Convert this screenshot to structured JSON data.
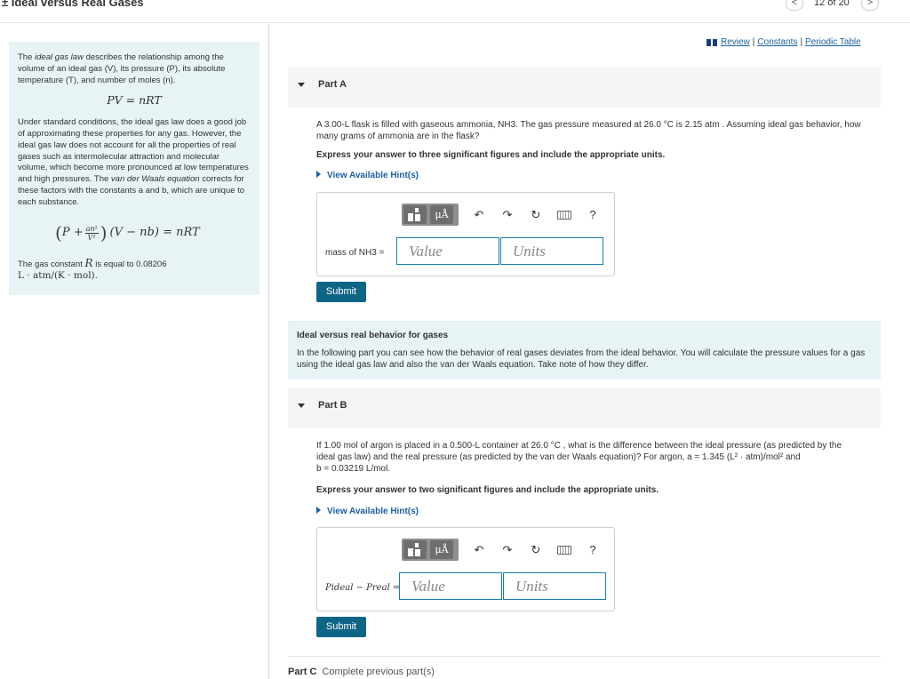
{
  "header": {
    "title": "± Ideal versus Real Gases",
    "pager_prev": "<",
    "pager_count": "12 of 20",
    "pager_next": ">"
  },
  "links": {
    "review": "Review",
    "constants": "Constants",
    "periodic": "Periodic Table",
    "sep": "|"
  },
  "left_panel": {
    "p1_a": "The ",
    "p1_em": "ideal gas law",
    "p1_b": " describes the relationship among the volume of an ideal gas (V), its pressure (P), its absolute temperature (T), and number of moles (n).",
    "eq1": "PV = nRT",
    "p2_a": "Under standard conditions, the ideal gas law does a good job of approximating these properties for any gas. However, the ideal gas law does not account for all the properties of real gases such as intermolecular attraction and molecular volume, which become more pronounced at low temperatures and high pressures. The ",
    "p2_em": "van der Waals equation",
    "p2_b": " corrects for these factors with the constants a and b, which are unique to each substance.",
    "eq2_p": "P +",
    "eq2_num": "an²",
    "eq2_den": "V²",
    "eq2_rest": "(V − nb) = nRT",
    "p3_a": "The gas constant ",
    "p3_R": "R",
    "p3_b": " is equal to 0.08206",
    "p3_units": "L · atm/(K · mol)."
  },
  "part_a": {
    "label": "Part A",
    "question": "A 3.00-L flask is filled with gaseous ammonia, NH3. The gas pressure measured at 26.0 °C is 2.15 atm . Assuming ideal gas behavior, how many grams of ammonia are in the flask?",
    "instruction": "Express your answer to three significant figures and include the appropriate units.",
    "hint": "View Available Hint(s)",
    "answer_label": "mass of NH3 =",
    "value_placeholder": "Value",
    "units_placeholder": "Units",
    "submit": "Submit"
  },
  "toolbar": {
    "mu": "μÅ",
    "undo": "↶",
    "redo": "↷",
    "reset": "↻",
    "help": "?"
  },
  "info": {
    "title": "Ideal versus real behavior for gases",
    "text": "In the following part you can see how the behavior of real gases deviates from the ideal behavior. You will calculate the pressure values for a gas using the ideal gas law and also the van der Waals equation. Take note of how they differ."
  },
  "part_b": {
    "label": "Part B",
    "question_l1": "If 1.00 mol of argon is placed in a 0.500-L container at 26.0 °C , what is the difference between the ideal pressure (as predicted by the",
    "question_l2": "ideal gas law) and the real pressure (as predicted by the van der Waals equation)? For argon, a = 1.345 (L² · atm)/mol² and",
    "question_l3": "b = 0.03219 L/mol.",
    "instruction": "Express your answer to two significant figures and include the appropriate units.",
    "hint": "View Available Hint(s)",
    "answer_label": "Pideal − Preal =",
    "value_placeholder": "Value",
    "units_placeholder": "Units",
    "submit": "Submit"
  },
  "part_c": {
    "label": "Part C",
    "status": "Complete previous part(s)"
  }
}
